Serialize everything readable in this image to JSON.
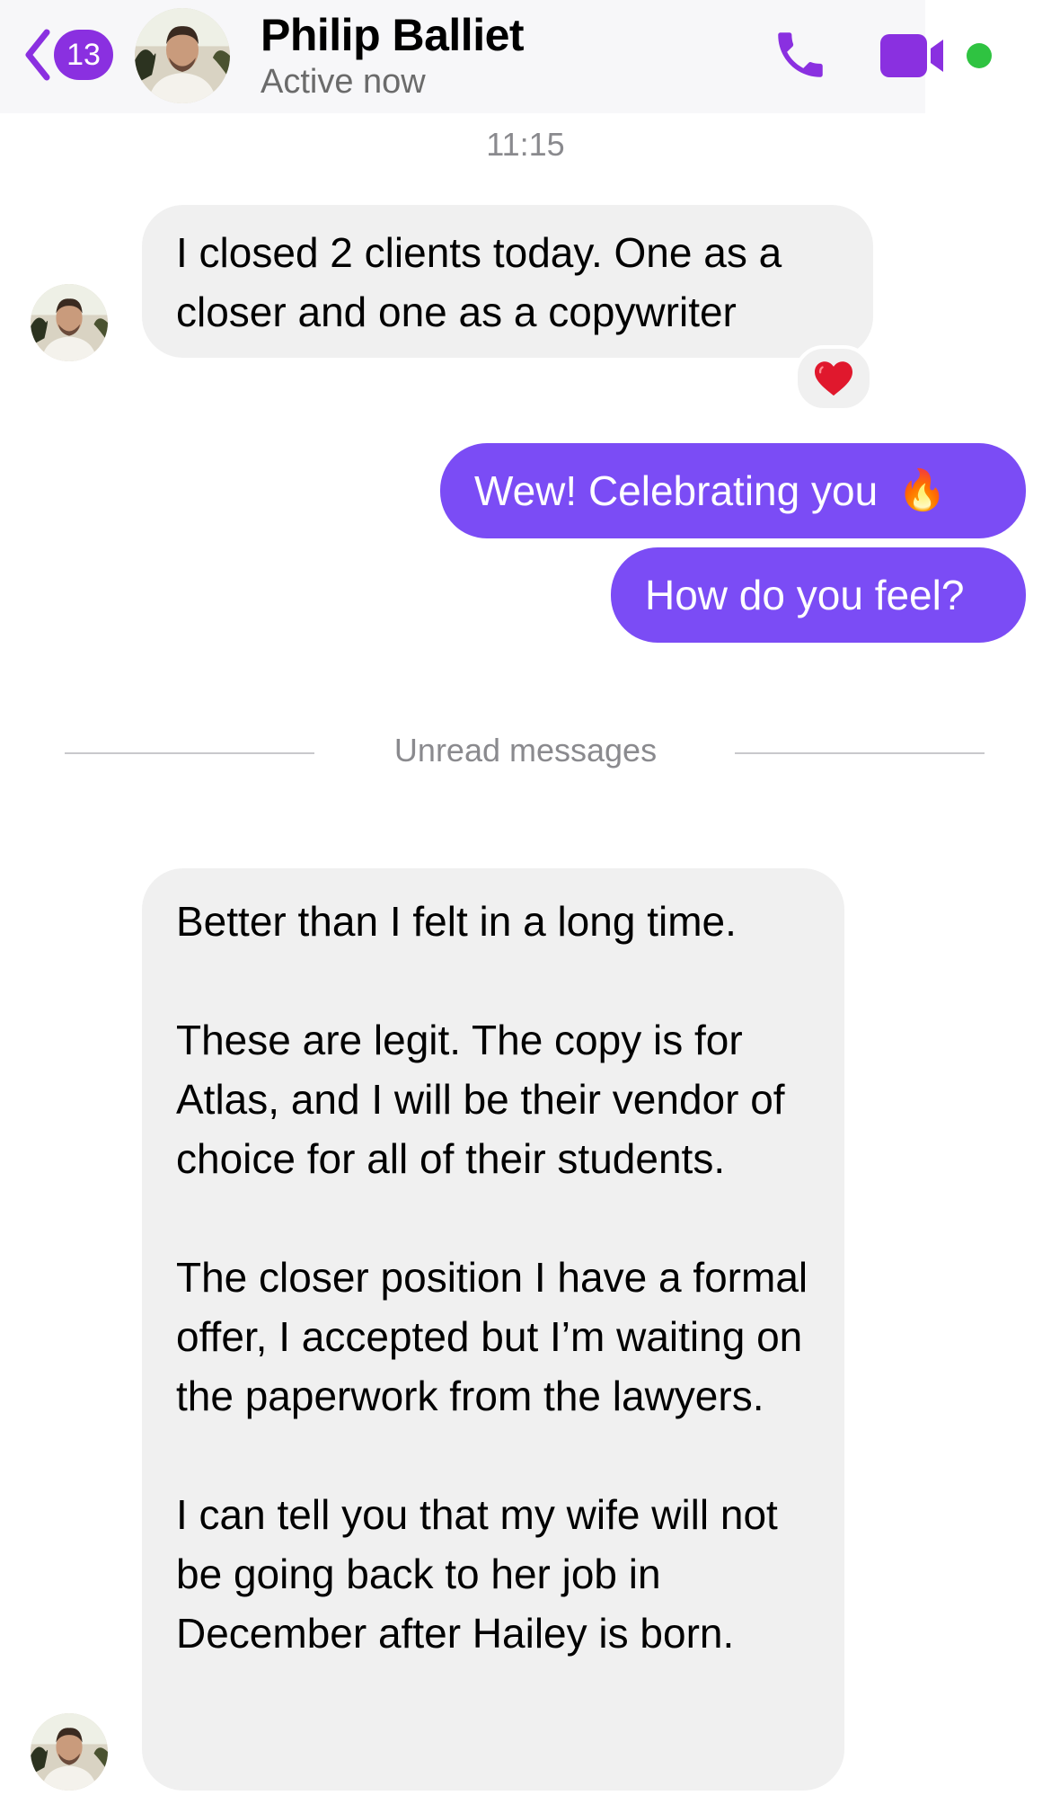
{
  "header": {
    "unread_count": "13",
    "contact_name": "Philip Balliet",
    "status": "Active now",
    "icons": {
      "back": "chevron-left-icon",
      "call": "phone-icon",
      "video": "video-camera-icon",
      "online": "online-indicator"
    },
    "accent_color": "#8a30e0"
  },
  "conversation": {
    "timestamp": "11:15",
    "messages": [
      {
        "direction": "incoming",
        "lines": [
          "I closed 2 clients today. One as a",
          "closer and one as a copywriter"
        ],
        "reaction": "heart"
      },
      {
        "direction": "outgoing",
        "text": "Wew! Celebrating you",
        "emoji": "🔥"
      },
      {
        "direction": "outgoing",
        "text": "How do you feel?"
      }
    ],
    "unread_divider": "Unread messages",
    "unread_message": {
      "direction": "incoming",
      "paragraphs": [
        "Better than I felt in a long time.",
        "These are legit. The copy is for Atlas, and I will be their vendor of choice for all of their students.",
        "The closer position I have a formal offer, I accepted but I’m waiting on the paperwork from the lawyers.",
        "I can tell you that my wife will not be going back to her job in December after Hailey is born."
      ]
    }
  },
  "colors": {
    "outgoing_bubble": "#7b4cf5",
    "incoming_bubble": "#f0f0f0",
    "online": "#2fc341"
  }
}
